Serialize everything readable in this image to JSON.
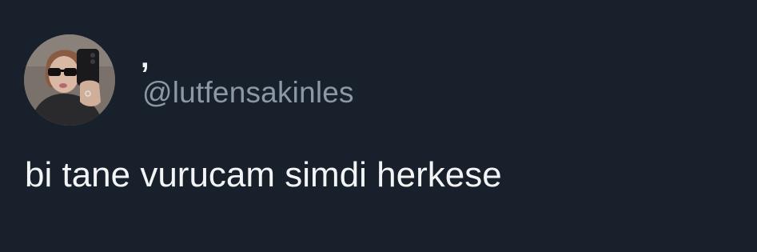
{
  "tweet": {
    "author": {
      "display_name": ",",
      "handle": "@lutfensakinles",
      "avatar_icon": "profile-photo-mirror-selfie"
    },
    "text": "bi tane vurucam simdi herkese"
  },
  "colors": {
    "background": "#18202b",
    "primary_text": "#e7e9ea",
    "secondary_text": "#8b98a5"
  }
}
